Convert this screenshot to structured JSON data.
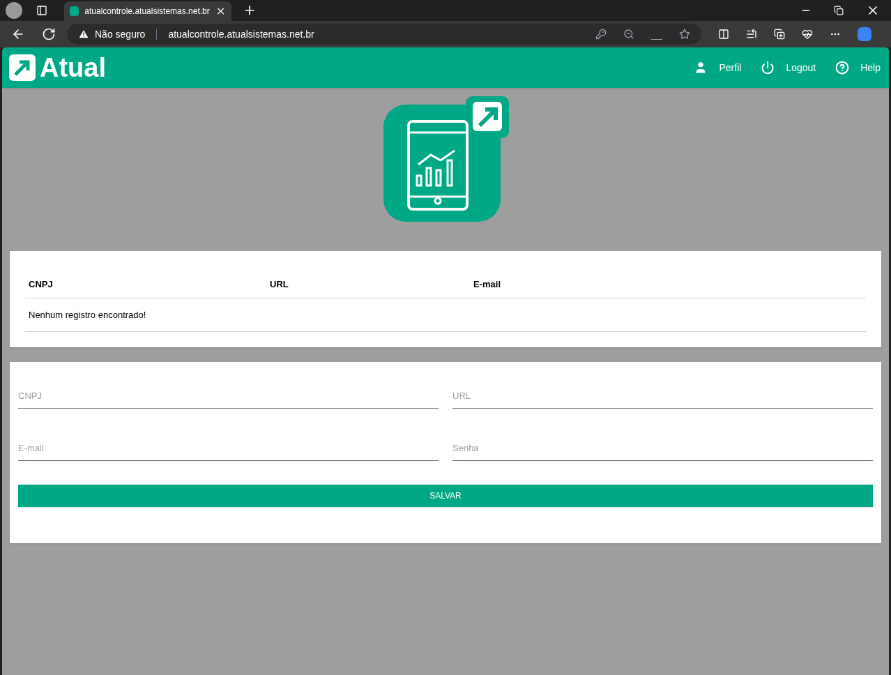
{
  "browser": {
    "tab_title": "atualcontrole.atualsistemas.net.br",
    "security": "Não seguro",
    "url": "atualcontrole.atualsistemas.net.br"
  },
  "header": {
    "logo": "Atual",
    "nav": [
      {
        "kind": "user",
        "label": "Perfil"
      },
      {
        "kind": "power",
        "label": "Logout"
      },
      {
        "kind": "help",
        "label": "Help"
      }
    ]
  },
  "table": {
    "columns": [
      "CNPJ",
      "URL",
      "E-mail"
    ],
    "empty_message": "Nenhum registro encontrado!"
  },
  "form": {
    "fields": [
      {
        "placeholder": "CNPJ"
      },
      {
        "placeholder": "URL"
      },
      {
        "placeholder": "E-mail"
      },
      {
        "placeholder": "Senha"
      }
    ],
    "button": "SALVAR"
  }
}
